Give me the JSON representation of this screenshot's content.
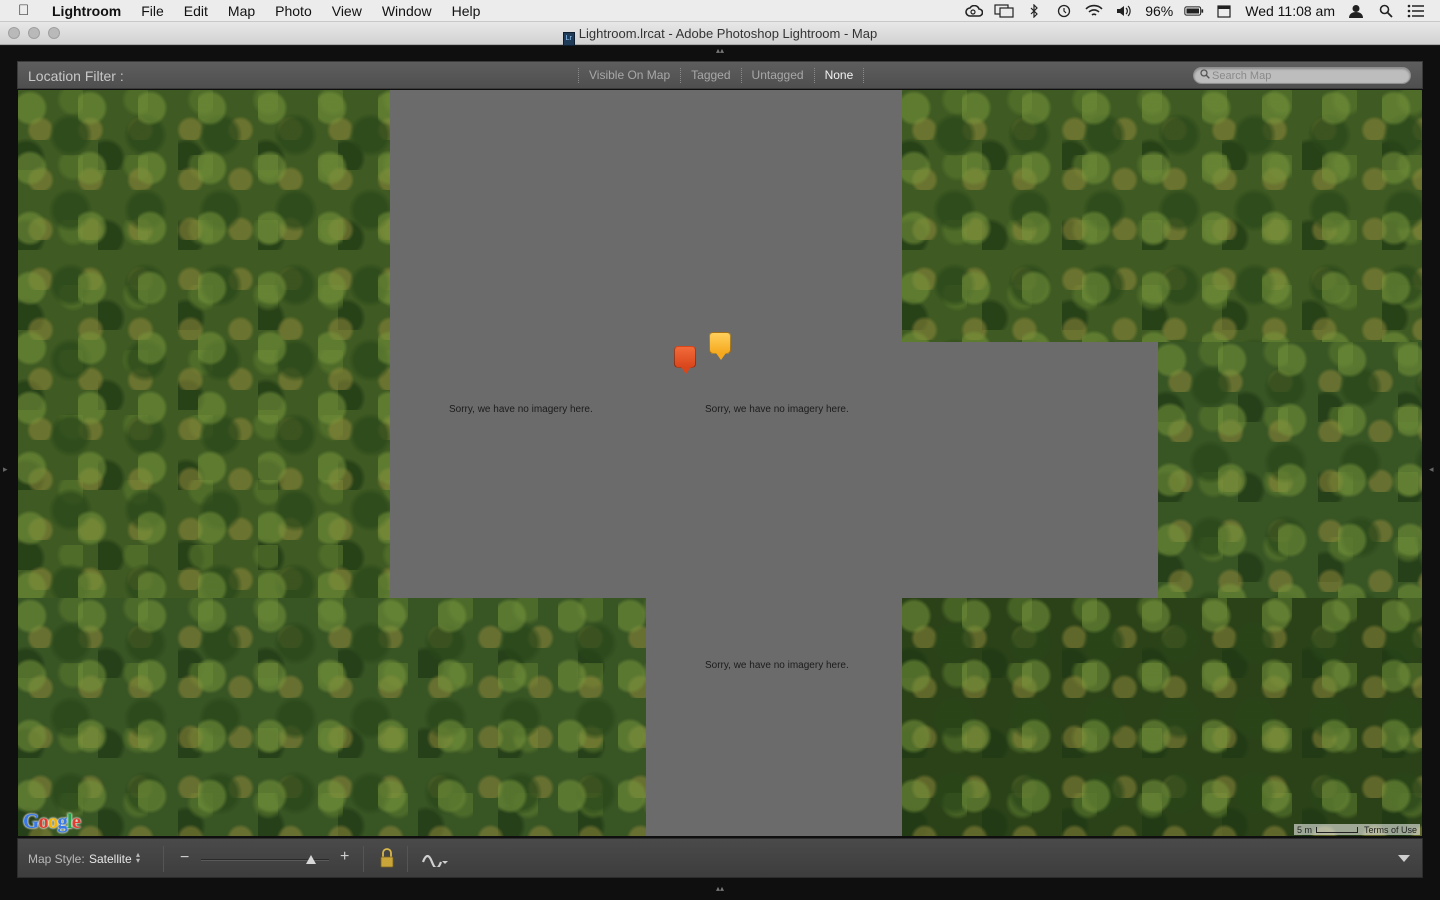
{
  "menubar": {
    "apple_icon": "apple-logo",
    "app_name": "Lightroom",
    "items": [
      "File",
      "Edit",
      "Map",
      "Photo",
      "View",
      "Window",
      "Help"
    ],
    "battery": "96%",
    "clock": "Wed 11:08 am",
    "status_icons": [
      "creative-cloud-icon",
      "display-mirroring-icon",
      "bluetooth-icon",
      "time-machine-icon",
      "wifi-icon",
      "volume-icon",
      "battery-icon",
      "calendar-icon",
      "user-icon",
      "spotlight-icon",
      "notification-center-icon"
    ]
  },
  "window": {
    "title": "Lightroom.lrcat - Adobe Photoshop Lightroom - Map",
    "doc_icon_text": "Lr"
  },
  "filter": {
    "label": "Location Filter :",
    "options": [
      "Visible On Map",
      "Tagged",
      "Untagged",
      "None"
    ],
    "selected": "None",
    "search_placeholder": "Search Map"
  },
  "map": {
    "no_imagery_text": "Sorry, we have no imagery here.",
    "provider_logo": "Google",
    "scale_label": "5 m",
    "terms_label": "Terms of Use",
    "pins": [
      {
        "color": "#e2522a",
        "name": "photo-marker-red"
      },
      {
        "color": "#f8b93a",
        "name": "photo-marker-yellow"
      }
    ]
  },
  "toolbar": {
    "map_style_label": "Map Style:",
    "map_style_value": "Satellite",
    "zoom_level": 0.86,
    "zoom_out_symbol": "−",
    "zoom_in_symbol": "+"
  }
}
